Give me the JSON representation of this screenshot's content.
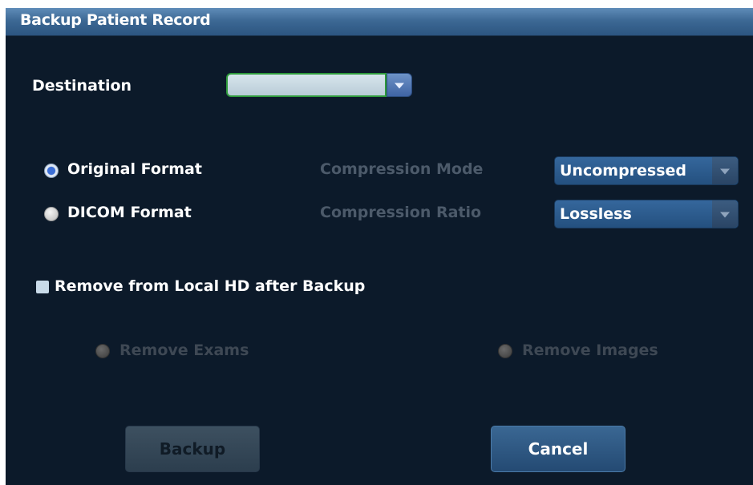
{
  "dialog": {
    "title": "Backup Patient Record",
    "destination_label": "Destination",
    "destination_value": "",
    "format": {
      "original_label": "Original Format",
      "dicom_label": "DICOM Format",
      "selected": "original"
    },
    "compression": {
      "mode_label": "Compression Mode",
      "mode_value": "Uncompressed",
      "ratio_label": "Compression Ratio",
      "ratio_value": "Lossless"
    },
    "remove_checkbox_label": "Remove from Local HD after Backup",
    "remove_checkbox_checked": false,
    "remove_exams_label": "Remove Exams",
    "remove_images_label": "Remove Images",
    "buttons": {
      "backup": "Backup",
      "cancel": "Cancel"
    }
  },
  "colors": {
    "background": "#0c1a2a",
    "title_bar": "#3d6995",
    "accent_green": "#2e9a3b",
    "dropdown_blue": "#3f64a4",
    "select_blue": "#24507f"
  },
  "icons": {
    "dropdown": "chevron-down-icon",
    "radio_on": "radio-selected-icon",
    "radio_off": "radio-unselected-icon"
  }
}
